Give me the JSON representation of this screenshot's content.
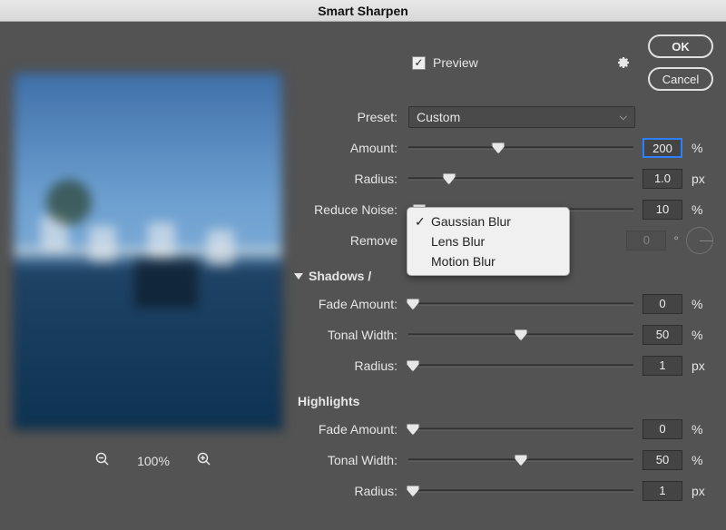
{
  "title": "Smart Sharpen",
  "top": {
    "preview_label": "Preview",
    "preview_checked": true
  },
  "buttons": {
    "ok": "OK",
    "cancel": "Cancel"
  },
  "preset": {
    "label": "Preset:",
    "value": "Custom"
  },
  "sliders": {
    "amount": {
      "label": "Amount:",
      "value": "200",
      "unit": "%",
      "pos": 40
    },
    "radius": {
      "label": "Radius:",
      "value": "1.0",
      "unit": "px",
      "pos": 18
    },
    "reduce_noise": {
      "label": "Reduce Noise:",
      "value": "10",
      "unit": "%",
      "pos": 5
    }
  },
  "remove": {
    "label": "Remove",
    "selected": "Gaussian Blur",
    "options": [
      "Gaussian Blur",
      "Lens Blur",
      "Motion Blur"
    ],
    "angle": "0"
  },
  "section_shadows_label": "Shadows /",
  "section_highlights_label": "Highlights",
  "shadows": {
    "fade": {
      "label": "Fade Amount:",
      "value": "0",
      "unit": "%",
      "pos": 2
    },
    "tonal": {
      "label": "Tonal Width:",
      "value": "50",
      "unit": "%",
      "pos": 50
    },
    "radius": {
      "label": "Radius:",
      "value": "1",
      "unit": "px",
      "pos": 2
    }
  },
  "highlights": {
    "fade": {
      "label": "Fade Amount:",
      "value": "0",
      "unit": "%",
      "pos": 2
    },
    "tonal": {
      "label": "Tonal Width:",
      "value": "50",
      "unit": "%",
      "pos": 50
    },
    "radius": {
      "label": "Radius:",
      "value": "1",
      "unit": "px",
      "pos": 2
    }
  },
  "zoom": {
    "level": "100%"
  }
}
